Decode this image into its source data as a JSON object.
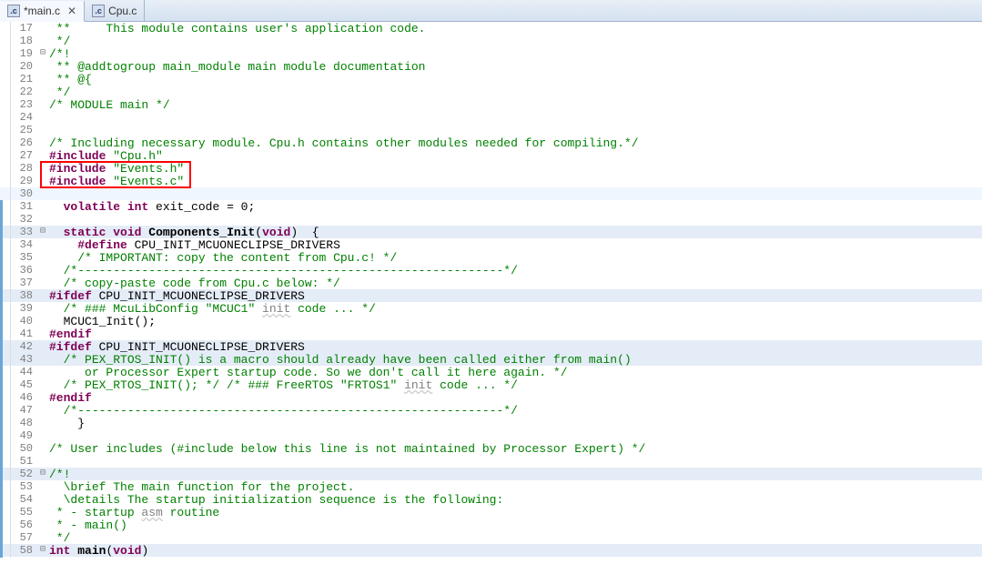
{
  "tabs": [
    {
      "label": "*main.c",
      "active": true,
      "hasClose": true
    },
    {
      "label": "Cpu.c",
      "active": false,
      "hasClose": false
    }
  ],
  "firstLineNumber": 17,
  "highlightBlue": [
    33,
    38,
    42,
    43,
    52,
    58
  ],
  "highlightCurrent": [
    30
  ],
  "foldMarks": {
    "19": "⊟",
    "33": "⊟",
    "52": "⊟",
    "58": "⊟"
  },
  "redBox": {
    "topLine": 28,
    "bottomLine": 29,
    "leftCh": 0,
    "rightPx": 166
  },
  "changedBarFromLine": 31,
  "lines": [
    [
      [
        "c-comment",
        " **     This module contains user's application code."
      ]
    ],
    [
      [
        "c-comment",
        " */"
      ]
    ],
    [
      [
        "c-comment",
        "/*!"
      ]
    ],
    [
      [
        "c-comment",
        " ** @addtogroup main_module main module documentation"
      ]
    ],
    [
      [
        "c-comment",
        " ** @{"
      ]
    ],
    [
      [
        "c-comment",
        " */"
      ]
    ],
    [
      [
        "c-comment",
        "/* MODULE main */"
      ]
    ],
    [
      [
        "c-text",
        ""
      ]
    ],
    [
      [
        "c-text",
        ""
      ]
    ],
    [
      [
        "c-comment",
        "/* Including necessary module. Cpu.h contains other modules needed for compiling.*/"
      ]
    ],
    [
      [
        "c-pp",
        "#include "
      ],
      [
        "c-string",
        "\"Cpu.h\""
      ]
    ],
    [
      [
        "c-pp",
        "#include "
      ],
      [
        "c-string",
        "\"Events.h\""
      ]
    ],
    [
      [
        "c-pp",
        "#include "
      ],
      [
        "c-string",
        "\"Events.c\""
      ]
    ],
    [
      [
        "c-text",
        ""
      ]
    ],
    [
      [
        "c-text",
        "  "
      ],
      [
        "c-kw",
        "volatile"
      ],
      [
        "c-text",
        " "
      ],
      [
        "c-kw",
        "int"
      ],
      [
        "c-text",
        " exit_code = 0;"
      ]
    ],
    [
      [
        "c-text",
        ""
      ]
    ],
    [
      [
        "c-text",
        "  "
      ],
      [
        "c-kw",
        "static"
      ],
      [
        "c-text",
        " "
      ],
      [
        "c-kw",
        "void"
      ],
      [
        "c-text",
        " "
      ],
      [
        "c-func",
        "Components_Init"
      ],
      [
        "c-text",
        "("
      ],
      [
        "c-kw",
        "void"
      ],
      [
        "c-text",
        ")  {"
      ]
    ],
    [
      [
        "c-text",
        "    "
      ],
      [
        "c-pp",
        "#define"
      ],
      [
        "c-text",
        " CPU_INIT_MCUONECLIPSE_DRIVERS"
      ]
    ],
    [
      [
        "c-text",
        "    "
      ],
      [
        "c-comment",
        "/* IMPORTANT: copy the content from Cpu.c! */"
      ]
    ],
    [
      [
        "c-text",
        "  "
      ],
      [
        "c-comment",
        "/*------------------------------------------------------------*/"
      ]
    ],
    [
      [
        "c-text",
        "  "
      ],
      [
        "c-comment",
        "/* copy-paste code from Cpu.c below: */"
      ]
    ],
    [
      [
        "c-pp",
        "#ifdef"
      ],
      [
        "c-text",
        " CPU_INIT_MCUONECLIPSE_DRIVERS"
      ]
    ],
    [
      [
        "c-text",
        "  "
      ],
      [
        "c-comment",
        "/* ### McuLibConfig \"MCUC1\" "
      ],
      [
        "c-dull",
        "init"
      ],
      [
        "c-comment",
        " code ... */"
      ]
    ],
    [
      [
        "c-text",
        "  MCUC1_Init();"
      ]
    ],
    [
      [
        "c-pp",
        "#endif"
      ]
    ],
    [
      [
        "c-pp",
        "#ifdef"
      ],
      [
        "c-text",
        " CPU_INIT_MCUONECLIPSE_DRIVERS"
      ]
    ],
    [
      [
        "c-text",
        "  "
      ],
      [
        "c-comment",
        "/* PEX_RTOS_INIT() is a macro should already have been called either from main()"
      ]
    ],
    [
      [
        "c-text",
        "     "
      ],
      [
        "c-comment",
        "or Processor Expert startup code. So we don't call it here again. */"
      ]
    ],
    [
      [
        "c-text",
        "  "
      ],
      [
        "c-comment",
        "/* PEX_RTOS_INIT(); */ /* ### FreeRTOS \"FRTOS1\" "
      ],
      [
        "c-dull",
        "init"
      ],
      [
        "c-comment",
        " code ... */"
      ]
    ],
    [
      [
        "c-pp",
        "#endif"
      ]
    ],
    [
      [
        "c-text",
        "  "
      ],
      [
        "c-comment",
        "/*------------------------------------------------------------*/"
      ]
    ],
    [
      [
        "c-text",
        "  "
      ],
      [
        "c-text",
        "  }"
      ]
    ],
    [
      [
        "c-text",
        ""
      ]
    ],
    [
      [
        "c-comment",
        "/* User includes (#include below this line is not maintained by Processor Expert) */"
      ]
    ],
    [
      [
        "c-text",
        ""
      ]
    ],
    [
      [
        "c-comment",
        "/*!"
      ]
    ],
    [
      [
        "c-text",
        "  "
      ],
      [
        "c-comment",
        "\\brief The main function for the project."
      ]
    ],
    [
      [
        "c-text",
        "  "
      ],
      [
        "c-comment",
        "\\details The startup initialization sequence is the following:"
      ]
    ],
    [
      [
        "c-comment",
        " * - startup "
      ],
      [
        "c-dull",
        "asm"
      ],
      [
        "c-comment",
        " routine"
      ]
    ],
    [
      [
        "c-comment",
        " * - main()"
      ]
    ],
    [
      [
        "c-comment",
        " */"
      ]
    ],
    [
      [
        "c-kw",
        "int"
      ],
      [
        "c-text",
        " "
      ],
      [
        "c-func",
        "main"
      ],
      [
        "c-text",
        "("
      ],
      [
        "c-kw",
        "void"
      ],
      [
        "c-text",
        ")"
      ]
    ]
  ]
}
